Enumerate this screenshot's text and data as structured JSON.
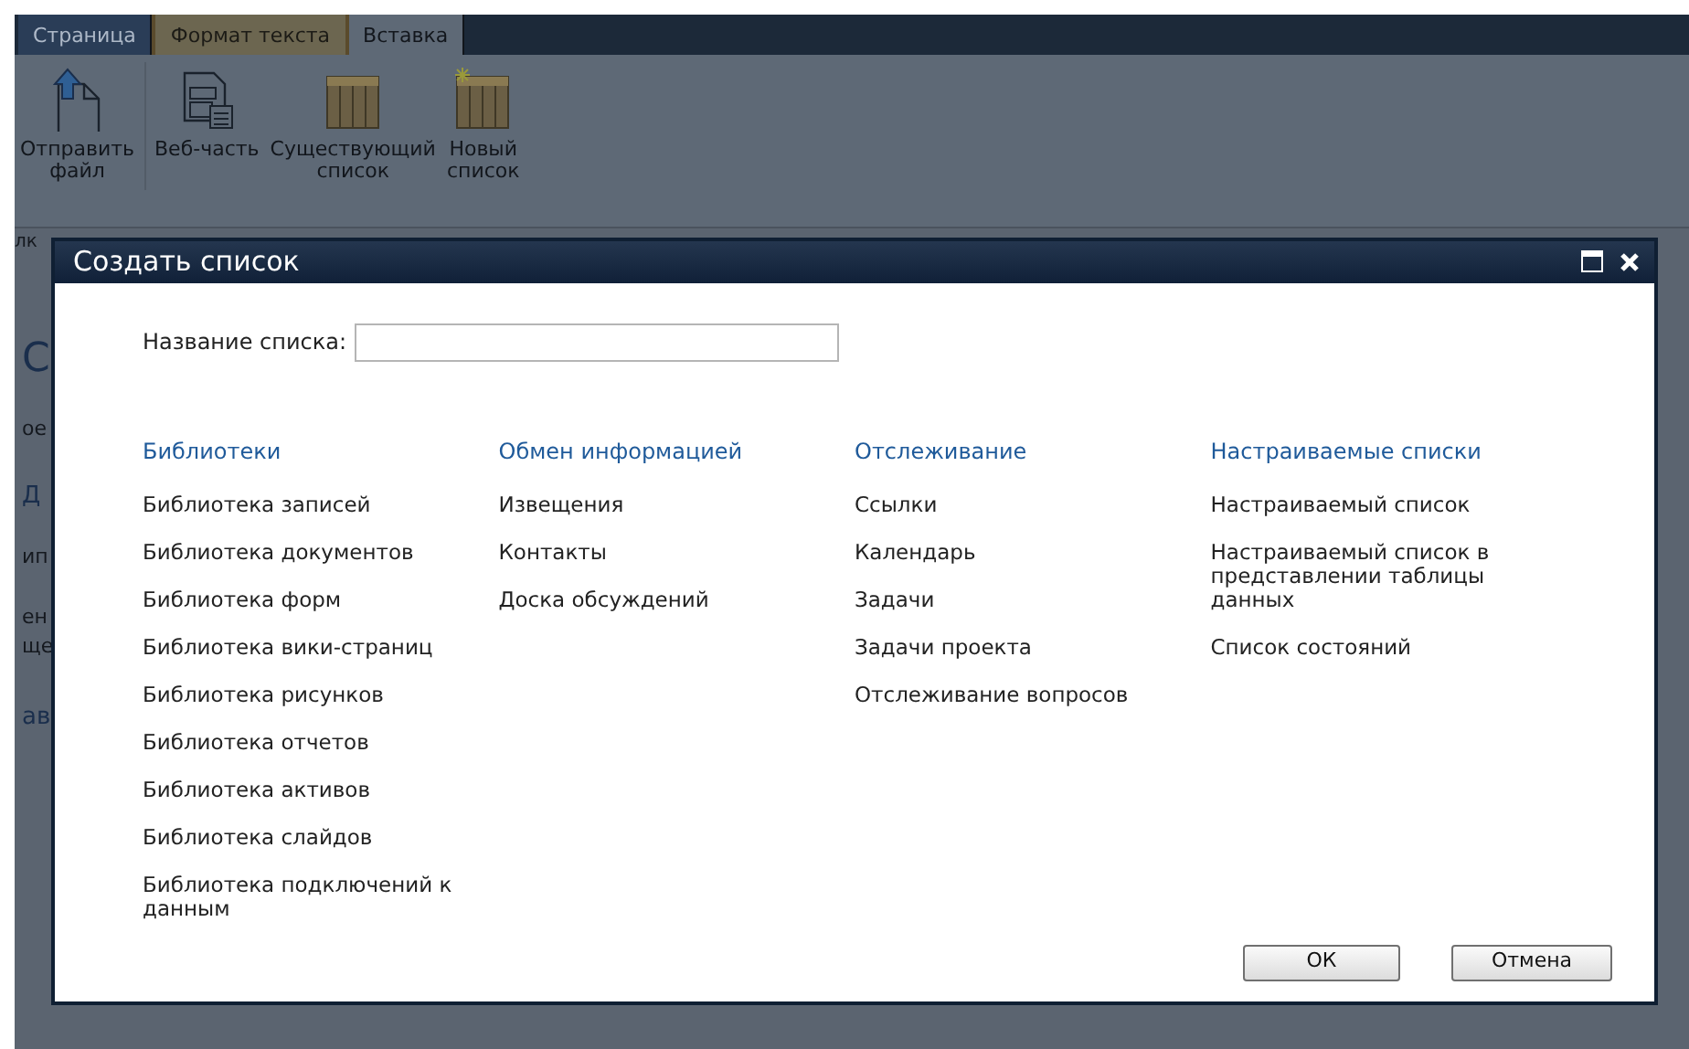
{
  "ribbon": {
    "tabs": [
      {
        "label": "Страница",
        "kind": "normal",
        "selected": false
      },
      {
        "label": "Формат текста",
        "kind": "contextual",
        "selected": false
      },
      {
        "label": "Вставка",
        "kind": "normal",
        "selected": true
      }
    ],
    "buttons": [
      {
        "label": "Отправить файл",
        "kind": "upload"
      },
      {
        "label": "Веб-часть",
        "kind": "webpart"
      },
      {
        "label": "Существующий список",
        "kind": "table"
      },
      {
        "label": "Новый список",
        "kind": "newtable"
      }
    ],
    "group_label": "лк"
  },
  "page_fragments": [
    {
      "text": "С",
      "kind": "title"
    },
    {
      "text": "ое",
      "kind": "text"
    },
    {
      "text": "Д",
      "kind": "link"
    },
    {
      "text": "ип",
      "kind": "text"
    },
    {
      "text": "ен",
      "kind": "text"
    },
    {
      "text": "ще",
      "kind": "text"
    },
    {
      "text": "ав",
      "kind": "link"
    }
  ],
  "dialog": {
    "title": "Создать список",
    "name_field": {
      "label": "Название списка:"
    },
    "columns": [
      {
        "heading": "Библиотеки",
        "items": [
          "Библиотека записей",
          "Библиотека документов",
          "Библиотека форм",
          "Библиотека вики-страниц",
          "Библиотека рисунков",
          "Библиотека отчетов",
          "Библиотека активов",
          "Библиотека слайдов",
          "Библиотека подключений к данным"
        ]
      },
      {
        "heading": "Обмен информацией",
        "items": [
          "Извещения",
          "Контакты",
          "Доска обсуждений"
        ]
      },
      {
        "heading": "Отслеживание",
        "items": [
          "Ссылки",
          "Календарь",
          "Задачи",
          "Задачи проекта",
          "Отслеживание вопросов"
        ]
      },
      {
        "heading": "Настраиваемые списки",
        "items": [
          "Настраиваемый список",
          "Настраиваемый список в представлении таблицы данных",
          "Список состояний"
        ]
      }
    ],
    "buttons": [
      "ОК",
      "Отмена"
    ]
  }
}
